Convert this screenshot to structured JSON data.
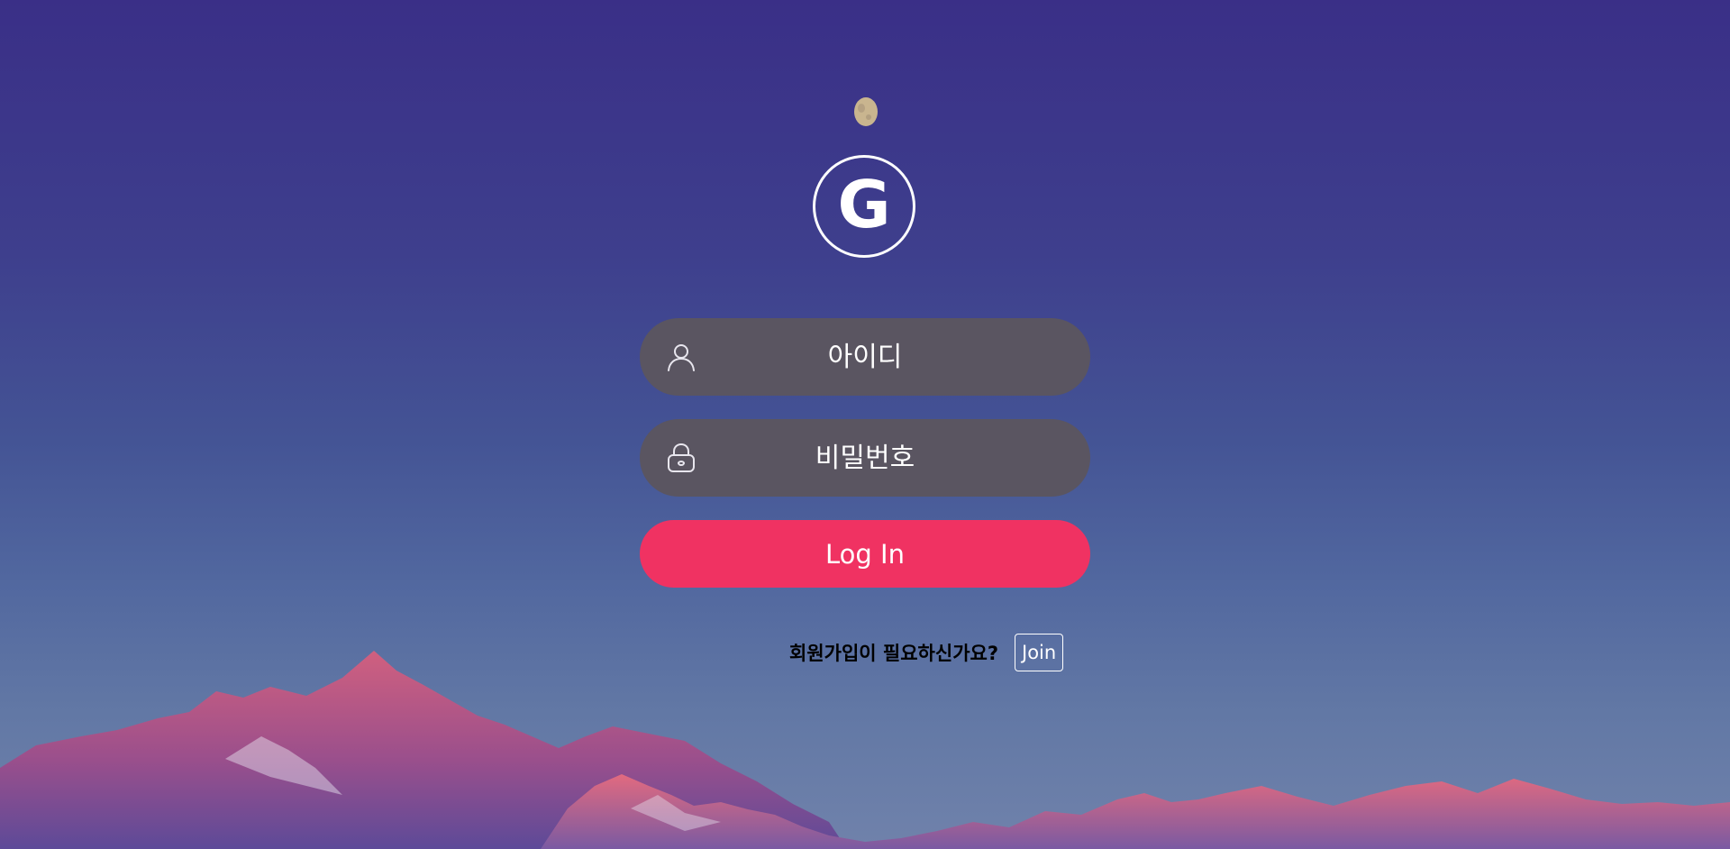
{
  "logo": {
    "letter": "G"
  },
  "login_form": {
    "id_placeholder": "아이디",
    "password_placeholder": "비밀번호",
    "login_label": "Log In"
  },
  "signup": {
    "prompt": "회원가입이 필요하신가요?",
    "join_label": "Join"
  },
  "icons": {
    "id_field": "user-icon",
    "password_field": "lock-icon"
  },
  "colors": {
    "background_top": "#3a2f87",
    "background_bottom": "#7082ab",
    "field_background": "#5a5561",
    "login_button": "#f03262",
    "text_light": "#ffffff",
    "signup_prompt": "#000000"
  }
}
